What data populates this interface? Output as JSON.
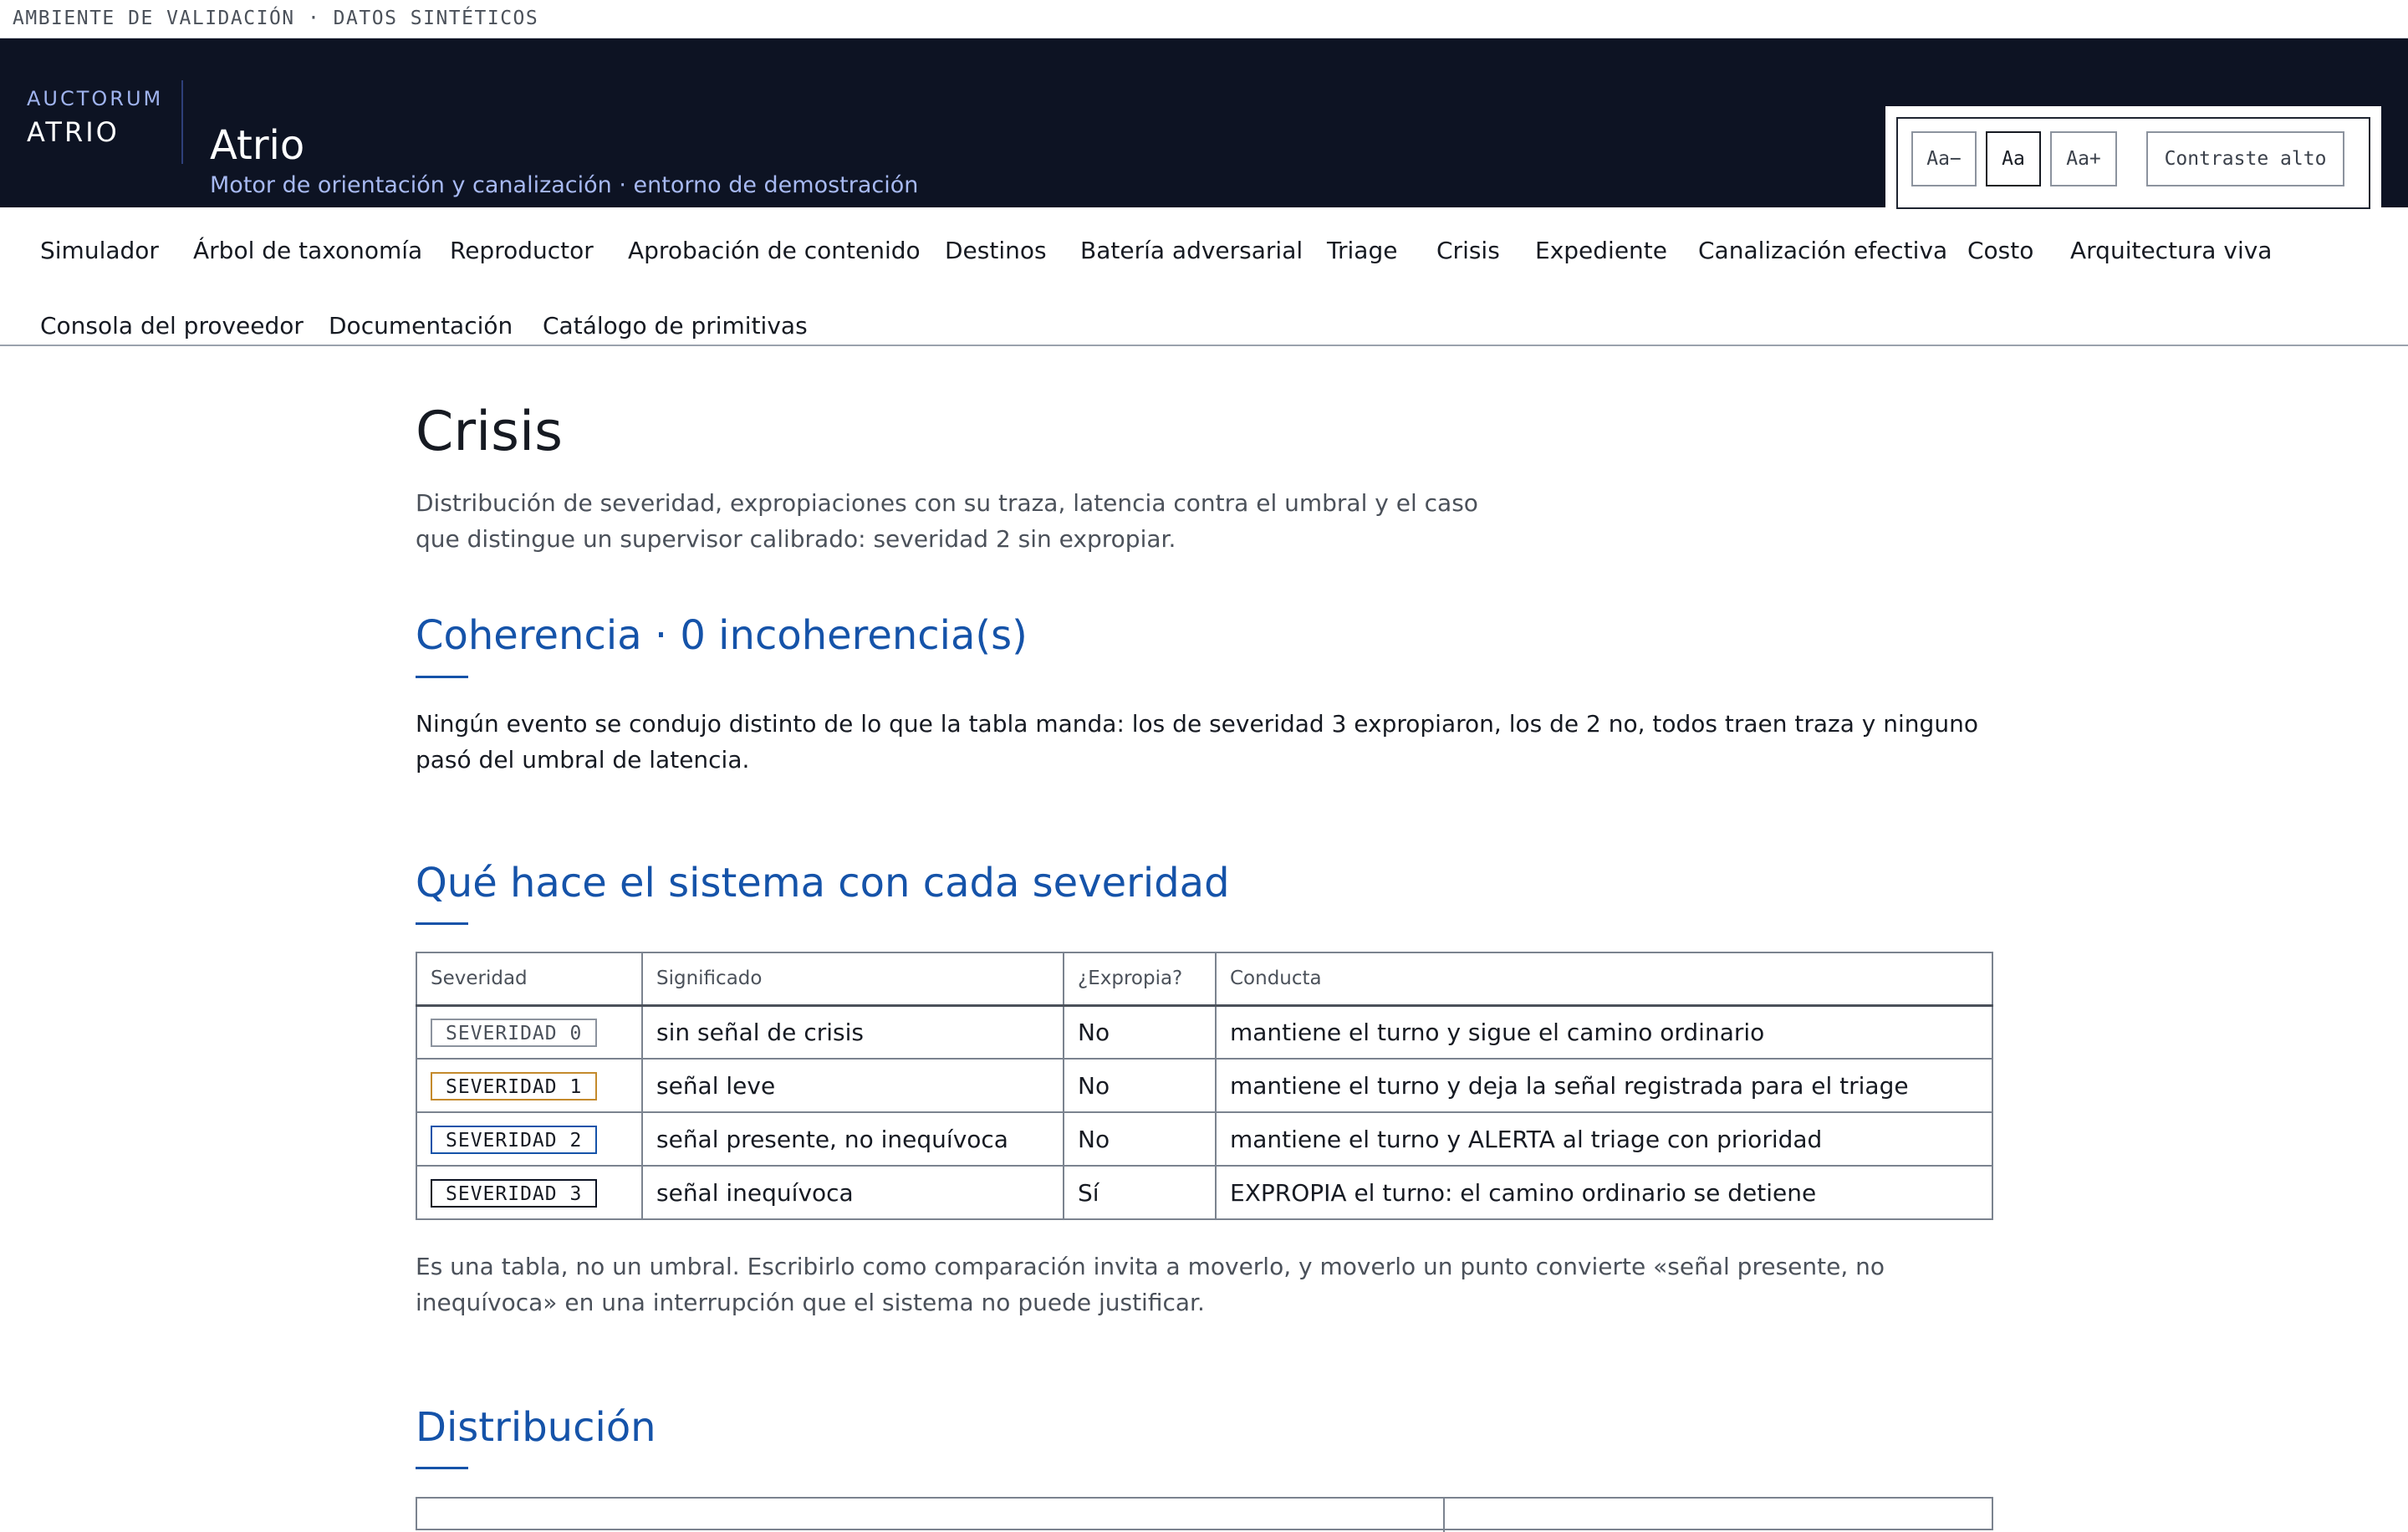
{
  "env_banner": "AMBIENTE DE VALIDACIÓN · DATOS SINTÉTICOS",
  "header": {
    "brand_top": "AUCTORUM",
    "brand_bottom": "ATRIO",
    "title": "Atrio",
    "subtitle": "Motor de orientación y canalización · entorno de demostración"
  },
  "accessibility": {
    "decrease": "Aa−",
    "default": "Aa",
    "increase": "Aa+",
    "contrast": "Contraste alto"
  },
  "nav": [
    "Simulador",
    "Árbol de taxonomía",
    "Reproductor",
    "Aprobación de contenido",
    "Destinos",
    "Batería adversarial",
    "Triage",
    "Crisis",
    "Expediente",
    "Canalización efectiva",
    "Costo",
    "Arquitectura viva",
    "Consola del proveedor",
    "Documentación",
    "Catálogo de primitivas"
  ],
  "page": {
    "title": "Crisis",
    "intro": "Distribución de severidad, expropiaciones con su traza, latencia contra el umbral y el caso que distingue un supervisor calibrado: severidad 2 sin expropiar."
  },
  "coherence": {
    "heading": "Coherencia · 0 incoherencia(s)",
    "text": "Ningún evento se condujo distinto de lo que la tabla manda: los de severidad 3 expropiaron, los de 2 no, todos traen traza y ninguno pasó del umbral de latencia."
  },
  "severity_section": {
    "heading": "Qué hace el sistema con cada severidad",
    "columns": [
      "Severidad",
      "Significado",
      "¿Expropia?",
      "Conducta"
    ],
    "rows": [
      {
        "badge": "SEVERIDAD 0",
        "meaning": "sin señal de crisis",
        "expropia": "No",
        "conduct": "mantiene el turno y sigue el camino ordinario",
        "color": "#8c939e",
        "text_color": "#4b515a"
      },
      {
        "badge": "SEVERIDAD 1",
        "meaning": "señal leve",
        "expropia": "No",
        "conduct": "mantiene el turno y deja la señal registrada para el triage",
        "color": "#c48a2c",
        "text_color": "#161a22"
      },
      {
        "badge": "SEVERIDAD 2",
        "meaning": "señal presente, no inequívoca",
        "expropia": "No",
        "conduct": "mantiene el turno y ALERTA al triage con prioridad",
        "color": "#1553a9",
        "text_color": "#161a22"
      },
      {
        "badge": "SEVERIDAD 3",
        "meaning": "señal inequívoca",
        "expropia": "Sí",
        "conduct": "EXPROPIA el turno: el camino ordinario se detiene",
        "color": "#0d1323",
        "text_color": "#161a22"
      }
    ],
    "note": "Es una tabla, no un umbral. Escribirlo como comparación invita a moverlo, y moverlo un punto convierte «señal presente, no inequívoca» en una interrupción que el sistema no puede justificar."
  },
  "distribution": {
    "heading": "Distribución"
  }
}
